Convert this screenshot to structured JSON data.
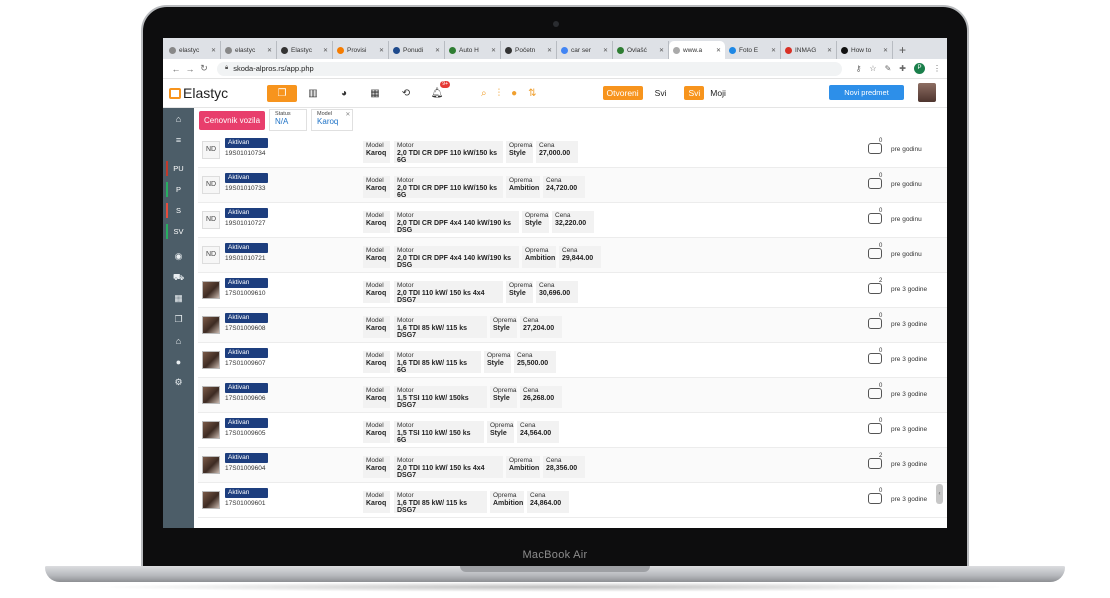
{
  "device": {
    "brand": "MacBook Air"
  },
  "browser": {
    "tabs": [
      {
        "title": "elastyc",
        "color": "#888888"
      },
      {
        "title": "elastyc",
        "color": "#888888"
      },
      {
        "title": "Elastyc",
        "color": "#333333"
      },
      {
        "title": "Provisi",
        "color": "#f57c00"
      },
      {
        "title": "Ponudi",
        "color": "#1e4a8c"
      },
      {
        "title": "Auto H",
        "color": "#2e7d32"
      },
      {
        "title": "Početn",
        "color": "#333333"
      },
      {
        "title": "car ser",
        "color": "#4285f4"
      },
      {
        "title": "Ovlašć",
        "color": "#2e7d32"
      },
      {
        "title": "www.a",
        "color": "#aaaaaa",
        "active": true
      },
      {
        "title": "Foto E",
        "color": "#1e88e5"
      },
      {
        "title": "INMAG",
        "color": "#d93025"
      },
      {
        "title": "How to",
        "color": "#111111"
      }
    ],
    "new_tab_symbol": "+",
    "url": "skoda-alpros.rs/app.php",
    "profile_initial": "P"
  },
  "header": {
    "logo": "Elastyc",
    "notification_count": "9+",
    "filter_open": "Otvoreni",
    "filter_all": "Svi",
    "filter_all_active": "Svi",
    "filter_mine": "Moji",
    "new_button": "Novi predmet"
  },
  "sidebar": {
    "items": [
      {
        "icon": "home-icon",
        "glyph": "⌂"
      },
      {
        "icon": "list-icon",
        "glyph": "≡"
      },
      {
        "label": "PU",
        "mark": "#c0392b"
      },
      {
        "label": "P",
        "mark": "#27ae60"
      },
      {
        "label": "S",
        "mark": "#e74c3c"
      },
      {
        "label": "SV",
        "mark": "#27ae60"
      },
      {
        "icon": "globe-icon",
        "glyph": "◉"
      },
      {
        "icon": "cart-icon",
        "glyph": "⛟"
      },
      {
        "icon": "grid-icon",
        "glyph": "▦"
      },
      {
        "icon": "copy-icon",
        "glyph": "❐"
      },
      {
        "icon": "bank-icon",
        "glyph": "⌂"
      },
      {
        "icon": "user-icon",
        "glyph": "●"
      },
      {
        "icon": "settings-icon",
        "glyph": "⚙"
      }
    ]
  },
  "filters": {
    "category": "Cenovnik vozila",
    "status_label": "Status",
    "status_value": "N/A",
    "model_label": "Model",
    "model_value": "Karoq"
  },
  "labels": {
    "model": "Model",
    "motor": "Motor",
    "oprema": "Oprema",
    "cena": "Cena"
  },
  "rows": [
    {
      "avatar": "ND",
      "status": "Aktivan",
      "id": "19S01010734",
      "model": "Karoq",
      "motor": "2,0 TDI CR DPF 110 kW/150 ks 6G",
      "oprema": "Style",
      "cena": "27,000.00",
      "comments": "0",
      "age": "pre godinu"
    },
    {
      "avatar": "ND",
      "status": "Aktivan",
      "id": "19S01010733",
      "model": "Karoq",
      "motor": "2,0 TDI CR DPF 110 kW/150 ks 6G",
      "oprema": "Ambition",
      "cena": "24,720.00",
      "comments": "0",
      "age": "pre godinu"
    },
    {
      "avatar": "ND",
      "status": "Aktivan",
      "id": "19S01010727",
      "model": "Karoq",
      "motor": "2,0 TDI CR DPF 4x4 140 kW/190 ks DSG",
      "oprema": "Style",
      "cena": "32,220.00",
      "comments": "0",
      "age": "pre godinu"
    },
    {
      "avatar": "ND",
      "status": "Aktivan",
      "id": "19S01010721",
      "model": "Karoq",
      "motor": "2,0 TDI CR DPF 4x4 140 kW/190 ks DSG",
      "oprema": "Ambition",
      "cena": "29,844.00",
      "comments": "0",
      "age": "pre godinu"
    },
    {
      "avatar": "",
      "status": "Aktivan",
      "id": "17S01009610",
      "model": "Karoq",
      "motor": "2,0 TDI 110 kW/ 150 ks 4x4 DSG7",
      "oprema": "Style",
      "cena": "30,696.00",
      "comments": "2",
      "age": "pre 3 godine"
    },
    {
      "avatar": "",
      "status": "Aktivan",
      "id": "17S01009608",
      "model": "Karoq",
      "motor": "1,6 TDI 85 kW/ 115 ks DSG7",
      "oprema": "Style",
      "cena": "27,204.00",
      "comments": "0",
      "age": "pre 3 godine"
    },
    {
      "avatar": "",
      "status": "Aktivan",
      "id": "17S01009607",
      "model": "Karoq",
      "motor": "1,6 TDI 85 kW/ 115 ks 6G",
      "oprema": "Style",
      "cena": "25,500.00",
      "comments": "0",
      "age": "pre 3 godine"
    },
    {
      "avatar": "",
      "status": "Aktivan",
      "id": "17S01009606",
      "model": "Karoq",
      "motor": "1,5 TSI 110 kW/ 150ks DSG7",
      "oprema": "Style",
      "cena": "26,268.00",
      "comments": "0",
      "age": "pre 3 godine"
    },
    {
      "avatar": "",
      "status": "Aktivan",
      "id": "17S01009605",
      "model": "Karoq",
      "motor": "1,5 TSI 110 kW/ 150 ks 6G",
      "oprema": "Style",
      "cena": "24,564.00",
      "comments": "0",
      "age": "pre 3 godine"
    },
    {
      "avatar": "",
      "status": "Aktivan",
      "id": "17S01009604",
      "model": "Karoq",
      "motor": "2,0 TDI 110 kW/ 150 ks 4x4 DSG7",
      "oprema": "Ambition",
      "cena": "28,356.00",
      "comments": "2",
      "age": "pre 3 godine"
    },
    {
      "avatar": "",
      "status": "Aktivan",
      "id": "17S01009601",
      "model": "Karoq",
      "motor": "1,6 TDI 85 kW/ 115 ks DSG7",
      "oprema": "Ambition",
      "cena": "24,864.00",
      "comments": "0",
      "age": "pre 3 godine"
    }
  ]
}
